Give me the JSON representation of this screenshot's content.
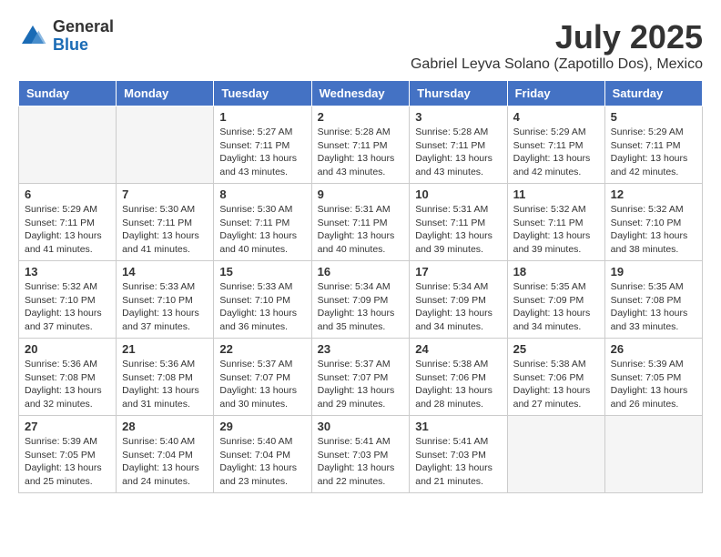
{
  "logo": {
    "general": "General",
    "blue": "Blue"
  },
  "title": "July 2025",
  "subtitle": "Gabriel Leyva Solano (Zapotillo Dos), Mexico",
  "days_of_week": [
    "Sunday",
    "Monday",
    "Tuesday",
    "Wednesday",
    "Thursday",
    "Friday",
    "Saturday"
  ],
  "weeks": [
    [
      {
        "day": "",
        "info": ""
      },
      {
        "day": "",
        "info": ""
      },
      {
        "day": "1",
        "sunrise": "5:27 AM",
        "sunset": "7:11 PM",
        "daylight": "13 hours and 43 minutes."
      },
      {
        "day": "2",
        "sunrise": "5:28 AM",
        "sunset": "7:11 PM",
        "daylight": "13 hours and 43 minutes."
      },
      {
        "day": "3",
        "sunrise": "5:28 AM",
        "sunset": "7:11 PM",
        "daylight": "13 hours and 43 minutes."
      },
      {
        "day": "4",
        "sunrise": "5:29 AM",
        "sunset": "7:11 PM",
        "daylight": "13 hours and 42 minutes."
      },
      {
        "day": "5",
        "sunrise": "5:29 AM",
        "sunset": "7:11 PM",
        "daylight": "13 hours and 42 minutes."
      }
    ],
    [
      {
        "day": "6",
        "sunrise": "5:29 AM",
        "sunset": "7:11 PM",
        "daylight": "13 hours and 41 minutes."
      },
      {
        "day": "7",
        "sunrise": "5:30 AM",
        "sunset": "7:11 PM",
        "daylight": "13 hours and 41 minutes."
      },
      {
        "day": "8",
        "sunrise": "5:30 AM",
        "sunset": "7:11 PM",
        "daylight": "13 hours and 40 minutes."
      },
      {
        "day": "9",
        "sunrise": "5:31 AM",
        "sunset": "7:11 PM",
        "daylight": "13 hours and 40 minutes."
      },
      {
        "day": "10",
        "sunrise": "5:31 AM",
        "sunset": "7:11 PM",
        "daylight": "13 hours and 39 minutes."
      },
      {
        "day": "11",
        "sunrise": "5:32 AM",
        "sunset": "7:11 PM",
        "daylight": "13 hours and 39 minutes."
      },
      {
        "day": "12",
        "sunrise": "5:32 AM",
        "sunset": "7:10 PM",
        "daylight": "13 hours and 38 minutes."
      }
    ],
    [
      {
        "day": "13",
        "sunrise": "5:32 AM",
        "sunset": "7:10 PM",
        "daylight": "13 hours and 37 minutes."
      },
      {
        "day": "14",
        "sunrise": "5:33 AM",
        "sunset": "7:10 PM",
        "daylight": "13 hours and 37 minutes."
      },
      {
        "day": "15",
        "sunrise": "5:33 AM",
        "sunset": "7:10 PM",
        "daylight": "13 hours and 36 minutes."
      },
      {
        "day": "16",
        "sunrise": "5:34 AM",
        "sunset": "7:09 PM",
        "daylight": "13 hours and 35 minutes."
      },
      {
        "day": "17",
        "sunrise": "5:34 AM",
        "sunset": "7:09 PM",
        "daylight": "13 hours and 34 minutes."
      },
      {
        "day": "18",
        "sunrise": "5:35 AM",
        "sunset": "7:09 PM",
        "daylight": "13 hours and 34 minutes."
      },
      {
        "day": "19",
        "sunrise": "5:35 AM",
        "sunset": "7:08 PM",
        "daylight": "13 hours and 33 minutes."
      }
    ],
    [
      {
        "day": "20",
        "sunrise": "5:36 AM",
        "sunset": "7:08 PM",
        "daylight": "13 hours and 32 minutes."
      },
      {
        "day": "21",
        "sunrise": "5:36 AM",
        "sunset": "7:08 PM",
        "daylight": "13 hours and 31 minutes."
      },
      {
        "day": "22",
        "sunrise": "5:37 AM",
        "sunset": "7:07 PM",
        "daylight": "13 hours and 30 minutes."
      },
      {
        "day": "23",
        "sunrise": "5:37 AM",
        "sunset": "7:07 PM",
        "daylight": "13 hours and 29 minutes."
      },
      {
        "day": "24",
        "sunrise": "5:38 AM",
        "sunset": "7:06 PM",
        "daylight": "13 hours and 28 minutes."
      },
      {
        "day": "25",
        "sunrise": "5:38 AM",
        "sunset": "7:06 PM",
        "daylight": "13 hours and 27 minutes."
      },
      {
        "day": "26",
        "sunrise": "5:39 AM",
        "sunset": "7:05 PM",
        "daylight": "13 hours and 26 minutes."
      }
    ],
    [
      {
        "day": "27",
        "sunrise": "5:39 AM",
        "sunset": "7:05 PM",
        "daylight": "13 hours and 25 minutes."
      },
      {
        "day": "28",
        "sunrise": "5:40 AM",
        "sunset": "7:04 PM",
        "daylight": "13 hours and 24 minutes."
      },
      {
        "day": "29",
        "sunrise": "5:40 AM",
        "sunset": "7:04 PM",
        "daylight": "13 hours and 23 minutes."
      },
      {
        "day": "30",
        "sunrise": "5:41 AM",
        "sunset": "7:03 PM",
        "daylight": "13 hours and 22 minutes."
      },
      {
        "day": "31",
        "sunrise": "5:41 AM",
        "sunset": "7:03 PM",
        "daylight": "13 hours and 21 minutes."
      },
      {
        "day": "",
        "info": ""
      },
      {
        "day": "",
        "info": ""
      }
    ]
  ]
}
